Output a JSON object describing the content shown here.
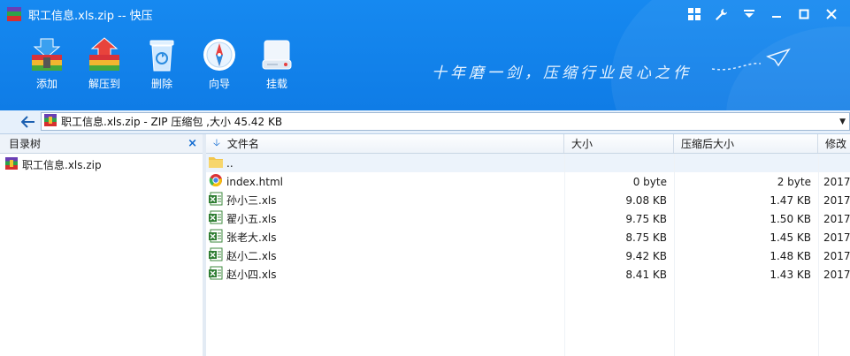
{
  "window": {
    "title": "职工信息.xls.zip -- 快压"
  },
  "toolbar": {
    "buttons": [
      {
        "label": "添加",
        "icon": "add-archive-icon"
      },
      {
        "label": "解压到",
        "icon": "extract-to-icon"
      },
      {
        "label": "删除",
        "icon": "recycle-bin-icon"
      },
      {
        "label": "向导",
        "icon": "compass-icon"
      },
      {
        "label": "挂载",
        "icon": "drive-mount-icon"
      }
    ],
    "slogan": "十年磨一剑，压缩行业良心之作"
  },
  "address": {
    "path": "职工信息.xls.zip - ZIP 压缩包 ,大小 45.42 KB"
  },
  "tree": {
    "header": "目录树",
    "close": "×",
    "items": [
      {
        "label": "职工信息.xls.zip"
      }
    ]
  },
  "file_list": {
    "columns": {
      "name": "文件名",
      "size": "大小",
      "compressed": "压缩后大小",
      "modified": "修改"
    },
    "parent": "..",
    "rows": [
      {
        "name": "index.html",
        "size": "0 byte",
        "compressed": "2 byte",
        "modified": "2017",
        "type": "html"
      },
      {
        "name": "孙小三.xls",
        "size": "9.08 KB",
        "compressed": "1.47 KB",
        "modified": "2017",
        "type": "xls"
      },
      {
        "name": "翟小五.xls",
        "size": "9.75 KB",
        "compressed": "1.50 KB",
        "modified": "2017",
        "type": "xls"
      },
      {
        "name": "张老大.xls",
        "size": "8.75 KB",
        "compressed": "1.45 KB",
        "modified": "2017",
        "type": "xls"
      },
      {
        "name": "赵小二.xls",
        "size": "9.42 KB",
        "compressed": "1.48 KB",
        "modified": "2017",
        "type": "xls"
      },
      {
        "name": "赵小四.xls",
        "size": "8.41 KB",
        "compressed": "1.43 KB",
        "modified": "2017",
        "type": "xls"
      }
    ]
  },
  "colors": {
    "accent": "#1689f0",
    "header_bg": "#eef3f9",
    "link": "#0f6ad1"
  }
}
